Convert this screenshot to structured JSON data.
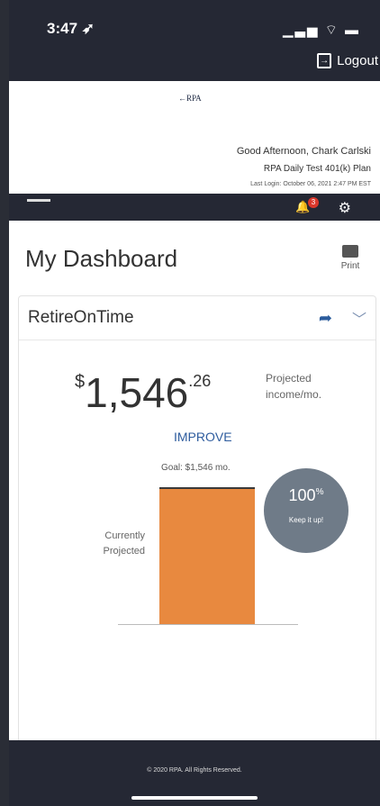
{
  "status_bar": {
    "time": "3:47 ➶",
    "icons": "▁▃▅ ⌔ ▬"
  },
  "top": {
    "logout_label": "Logout"
  },
  "header": {
    "logo": "←RPA",
    "greeting": "Good Afternoon,  Chark Carlski",
    "plan": "RPA Daily Test 401(k) Plan",
    "last_login": "Last Login: October 06, 2021 2:47 PM EST"
  },
  "nav": {
    "notification_count": "3"
  },
  "dashboard": {
    "title": "My Dashboard",
    "print_label": "Print"
  },
  "card": {
    "title": "RetireOnTime",
    "currency_symbol": "$",
    "amount_whole": "1,546",
    "amount_cents": ".26",
    "projected_label": "Projected income/mo.",
    "improve_label": "IMPROVE",
    "goal_label": "Goal: $1,546 mo.",
    "currently_label": "Currently Projected",
    "progress_percent": 100,
    "progress_label": "100",
    "progress_suffix": "%",
    "progress_message": "Keep it up!",
    "bar_color": "#e8893f"
  },
  "footer": {
    "copyright": "© 2020 RPA. All Rights Reserved."
  }
}
